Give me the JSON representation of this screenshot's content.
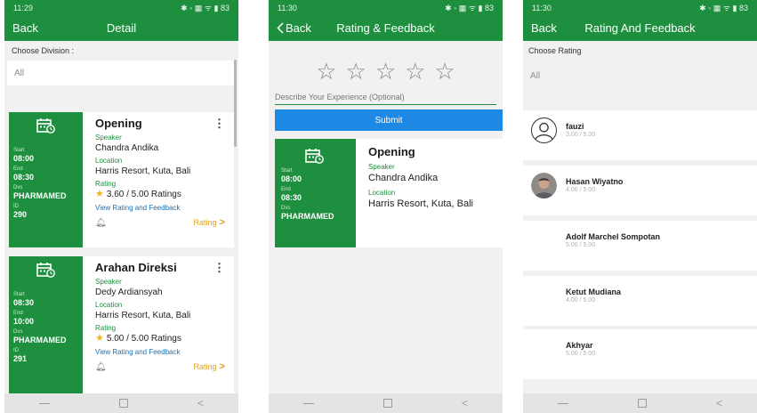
{
  "screens": {
    "detail": {
      "status": {
        "time": "11:29",
        "icons": "✱ ◦ ▦ ᯤ ▮ 83"
      },
      "back_label": "Back",
      "title": "Detail",
      "division": {
        "label": "Choose Division :",
        "value": "All"
      },
      "events": [
        {
          "title": "Opening",
          "start_label": "Start",
          "start": "08:00",
          "end_label": "End",
          "end": "08:30",
          "div_label": "Dvs",
          "division": "PHARMAMED",
          "id_label": "ID",
          "id": "290",
          "speaker_label": "Speaker",
          "speaker": "Chandra Andika",
          "location_label": "Location",
          "location": "Harris Resort, Kuta, Bali",
          "rating_label": "Rating",
          "rating": "3.60 / 5.00 Ratings",
          "link": "View Rating and Feedback",
          "rating_button": "Rating"
        },
        {
          "title": "Arahan Direksi",
          "start_label": "Start",
          "start": "08:30",
          "end_label": "End",
          "end": "10:00",
          "div_label": "Dvs",
          "division": "PHARMAMED",
          "id_label": "ID",
          "id": "291",
          "speaker_label": "Speaker",
          "speaker": "Dedy Ardiansyah",
          "location_label": "Location",
          "location": "Harris Resort, Kuta, Bali",
          "rating_label": "Rating",
          "rating": "5.00 / 5.00 Ratings",
          "link": "View Rating and Feedback",
          "rating_button": "Rating"
        }
      ]
    },
    "rating_form": {
      "status": {
        "time": "11:30",
        "icons": "✱ ◦ ▦ ᯤ ▮ 83"
      },
      "back_label": "Back",
      "title": "Rating & Feedback",
      "stars": 5,
      "placeholder": "Describe Your Experience (Optional)",
      "submit_label": "Submit",
      "event": {
        "title": "Opening",
        "start_label": "Start",
        "start": "08:00",
        "end_label": "End",
        "end": "08:30",
        "div_label": "Dvs",
        "division": "PHARMAMED",
        "speaker_label": "Speaker",
        "speaker": "Chandra Andika",
        "location_label": "Location",
        "location": "Harris Resort, Kuta, Bali"
      }
    },
    "feedback_list": {
      "status": {
        "time": "11:30",
        "icons": "✱ ◦ ▦ ᯤ ▮ 83"
      },
      "back_label": "Back",
      "title": "Rating And Feedback",
      "choose_label": "Choose Rating",
      "choose_value": "All",
      "reviews": [
        {
          "name": "fauzi",
          "score": "3.00 / 5.00",
          "avatar": "placeholder-icon"
        },
        {
          "name": "Hasan Wiyatno",
          "score": "4.00 / 5.00",
          "avatar": "photo"
        },
        {
          "name": "Adolf Marchel Sompotan",
          "score": "5.00 / 5.00",
          "avatar": "none"
        },
        {
          "name": "Ketut Mudiana",
          "score": "4.00 / 5.00",
          "avatar": "none"
        },
        {
          "name": "Akhyar",
          "score": "5.00 / 5.00",
          "avatar": "none"
        }
      ]
    }
  },
  "colors": {
    "primary": "#1e8f3e",
    "submit": "#1e88e5",
    "star": "#f0b323",
    "link": "#1a6fb8",
    "rating_button": "#e0a020"
  }
}
